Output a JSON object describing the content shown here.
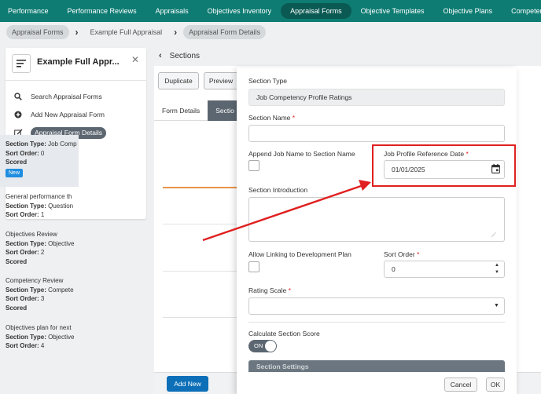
{
  "nav": {
    "items": [
      {
        "label": "Performance"
      },
      {
        "label": "Performance Reviews"
      },
      {
        "label": "Appraisals"
      },
      {
        "label": "Objectives Inventory"
      },
      {
        "label": "Appraisal Forms"
      },
      {
        "label": "Objective Templates"
      },
      {
        "label": "Objective Plans"
      },
      {
        "label": "Competency Profi"
      }
    ],
    "active_index": 4
  },
  "breadcrumb": {
    "items": [
      {
        "label": "Appraisal Forms"
      },
      {
        "label": "Example Full Appraisal"
      },
      {
        "label": "Appraisal Form Details"
      }
    ]
  },
  "left_panel": {
    "title": "Example Full Appr...",
    "items": [
      {
        "label": "Search Appraisal Forms"
      },
      {
        "label": "Add New Appraisal Form"
      },
      {
        "label": "Appraisal Form Details"
      }
    ]
  },
  "main": {
    "title": "Sections",
    "duplicate_label": "Duplicate",
    "preview_label": "Preview",
    "tabs": [
      {
        "label": "Form Details"
      },
      {
        "label": "Sectio"
      }
    ],
    "add_new_label": "Add New",
    "section_type_label": "Section Type:",
    "sort_order_label": "Sort Order:",
    "sections": [
      {
        "title": "",
        "type": "Job Comp",
        "sort": "0",
        "scored": "Scored",
        "badge": "New"
      },
      {
        "title": "General performance th",
        "type": "Question",
        "sort": "1",
        "scored": "",
        "badge": ""
      },
      {
        "title": "Objectives Review",
        "type": "Objective",
        "sort": "2",
        "scored": "Scored",
        "badge": ""
      },
      {
        "title": "Competency Review",
        "type": "Compete",
        "sort": "3",
        "scored": "Scored",
        "badge": ""
      },
      {
        "title": "Objectives plan for next",
        "type": "Objective",
        "sort": "4",
        "scored": "",
        "badge": ""
      }
    ]
  },
  "modal": {
    "section_type_label": "Section Type",
    "section_type_value": "Job Competency Profile Ratings",
    "section_name_label": "Section Name",
    "required_mark": "*",
    "section_name_value": "",
    "append_job_label": "Append Job Name to Section Name",
    "ref_date_label": "Job Profile Reference Date",
    "ref_date_value": "01/01/2025",
    "intro_label": "Section Introduction",
    "allow_linking_label": "Allow Linking to Development Plan",
    "sort_order_label": "Sort Order",
    "sort_order_value": "0",
    "rating_scale_label": "Rating Scale",
    "calc_score_label": "Calculate Section Score",
    "toggle_label": "ON",
    "section_settings_label": "Section Settings",
    "cancel_label": "Cancel",
    "ok_label": "OK"
  },
  "colors": {
    "nav_bg": "#0e7c73",
    "primary": "#0c6fb8",
    "annotation": "#e02020",
    "accent_badge": "#1f8de0"
  }
}
